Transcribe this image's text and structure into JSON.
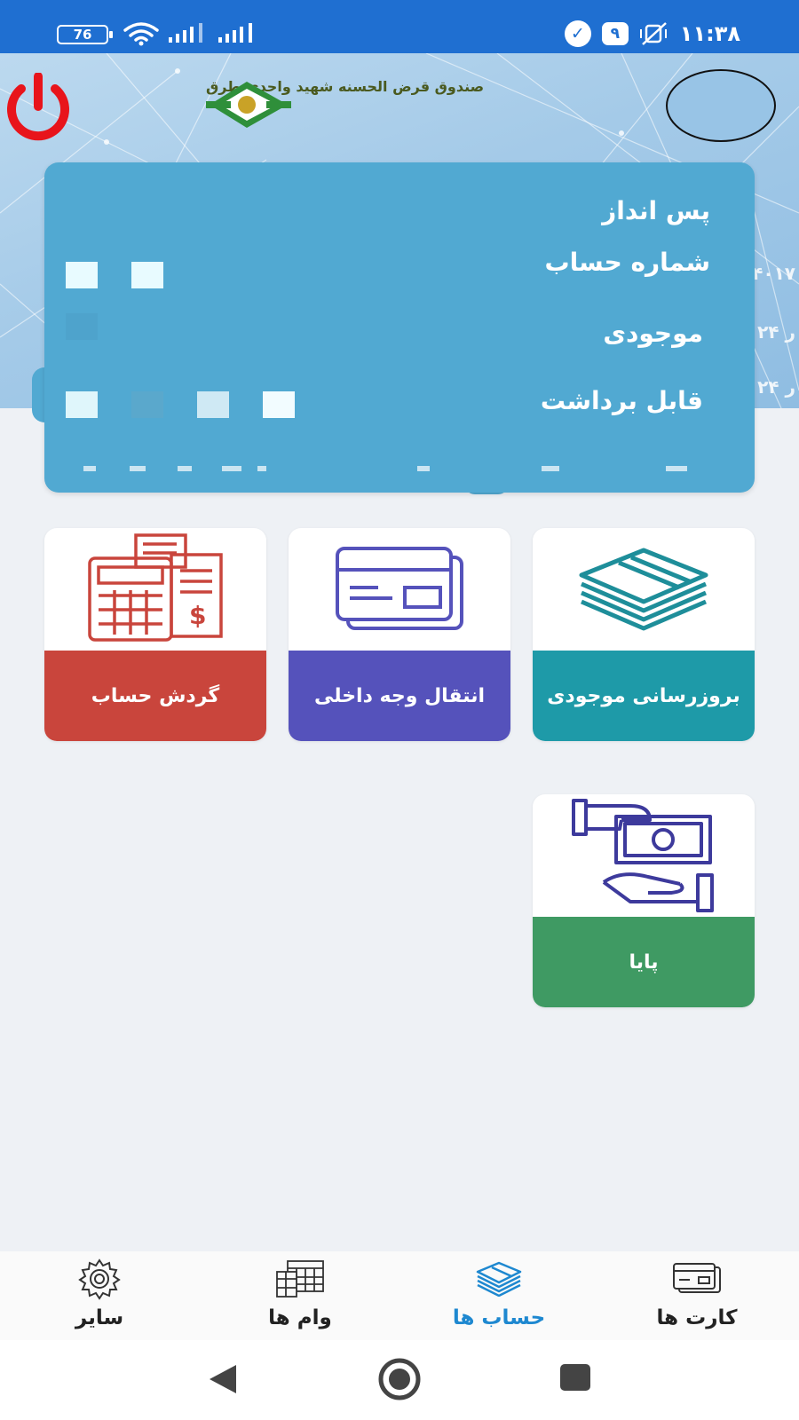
{
  "status_bar": {
    "battery": "76",
    "time": "۱۱:۳۸",
    "notification_badge": "۹",
    "icons": [
      "battery-icon",
      "wifi-icon",
      "signal-icon",
      "signal-icon",
      "check-circle-icon",
      "notification-badge",
      "mute-icon"
    ]
  },
  "header": {
    "brand_name": "صندوق قرض الحسنه شهید واحدی طرق",
    "icons": [
      "power-icon",
      "brand-logo-icon",
      "avatar"
    ]
  },
  "background_peek": {
    "number_fragment": "۴۰۱۷",
    "amount_fragment_1": "۲۴ ر",
    "amount_fragment_2": "۲۴ ر"
  },
  "account_card": {
    "account_type": "پس انداز",
    "account_number_label": "شماره حساب",
    "balance_label": "موجودی",
    "withdrawable_label": "قابل برداشت"
  },
  "tiles": [
    {
      "label": "بروزرسانی موجودی",
      "icon": "money-stack-icon",
      "color": "#1e9aa8"
    },
    {
      "label": "انتقال وجه داخلی",
      "icon": "cards-icon",
      "color": "#5552bb"
    },
    {
      "label": "گردش حساب",
      "icon": "calculator-invoice-icon",
      "color": "#c9453c"
    },
    {
      "label": "پایا",
      "icon": "hand-money-icon",
      "color": "#3f9a63"
    }
  ],
  "bottom_nav": {
    "items": [
      {
        "label": "کارت ها",
        "icon": "cards-icon",
        "active": false
      },
      {
        "label": "حساب ها",
        "icon": "money-stack-icon",
        "active": true
      },
      {
        "label": "وام ها",
        "icon": "calendar-icon",
        "active": false
      },
      {
        "label": "سایر",
        "icon": "gear-icon",
        "active": false
      }
    ],
    "active_color": "#1e88d0"
  },
  "android_nav": {
    "icons": [
      "back-icon",
      "home-icon",
      "recents-icon"
    ]
  }
}
